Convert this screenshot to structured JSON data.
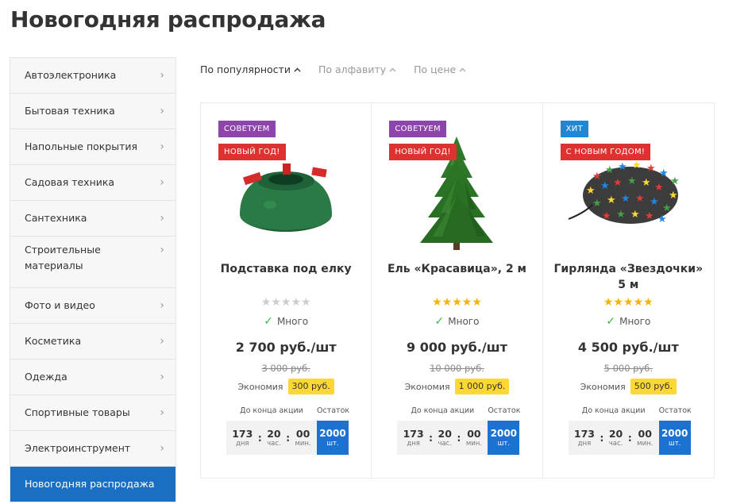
{
  "page": {
    "title": "Новогодняя распродажа"
  },
  "sidebar": {
    "items": [
      {
        "label": "Автоэлектроника"
      },
      {
        "label": "Бытовая техника"
      },
      {
        "label": "Напольные покрытия"
      },
      {
        "label": "Садовая техника"
      },
      {
        "label": "Сантехника"
      },
      {
        "label": "Строительные материалы"
      },
      {
        "label": "Фото и видео"
      },
      {
        "label": "Косметика"
      },
      {
        "label": "Одежда"
      },
      {
        "label": "Спортивные товары"
      },
      {
        "label": "Электроинструмент"
      },
      {
        "label": "Новогодняя распродажа"
      }
    ]
  },
  "sort": {
    "popularity": "По популярности",
    "alphabet": "По алфавиту",
    "price": "По цене"
  },
  "products": [
    {
      "badge1": "СОВЕТУЕМ",
      "badge2": "НОВЫЙ ГОД!",
      "name": "Подставка под елку",
      "rating": 0,
      "stock": "Много",
      "price": "2 700 руб./шт",
      "old_price": "3 000 руб.",
      "savings_label": "Экономия",
      "savings": "300 руб.",
      "timer_label": "До конца акции",
      "remain_label": "Остаток",
      "days": "173",
      "days_u": "дня",
      "hours": "20",
      "hours_u": "час.",
      "mins": "00",
      "mins_u": "мин.",
      "remain": "2000",
      "remain_u": "шт."
    },
    {
      "badge1": "СОВЕТУЕМ",
      "badge2": "НОВЫЙ ГОД!",
      "name": "Ель «Красавица», 2 м",
      "rating": 5,
      "stock": "Много",
      "price": "9 000 руб./шт",
      "old_price": "10 000 руб.",
      "savings_label": "Экономия",
      "savings": "1 000 руб.",
      "timer_label": "До конца акции",
      "remain_label": "Остаток",
      "days": "173",
      "days_u": "дня",
      "hours": "20",
      "hours_u": "час.",
      "mins": "00",
      "mins_u": "мин.",
      "remain": "2000",
      "remain_u": "шт."
    },
    {
      "badge1": "ХИТ",
      "badge2": "С НОВЫМ ГОДОМ!",
      "name": "Гирлянда «Звездочки» 5 м",
      "rating": 5,
      "stock": "Много",
      "price": "4 500 руб./шт",
      "old_price": "5 000 руб.",
      "savings_label": "Экономия",
      "savings": "500 руб.",
      "timer_label": "До конца акции",
      "remain_label": "Остаток",
      "days": "173",
      "days_u": "дня",
      "hours": "20",
      "hours_u": "час.",
      "mins": "00",
      "mins_u": "мин.",
      "remain": "2000",
      "remain_u": "шт."
    }
  ],
  "colors": {
    "accent": "#1b6fc2",
    "badge_recommend": "#8e44ad",
    "badge_newyear": "#e03131",
    "badge_hit": "#1e88d6",
    "star": "#f6b400",
    "savings_bg": "#fdd835",
    "stock_check": "#3bb54a"
  },
  "icons": {
    "chevron": "chevron-right-icon",
    "sort_arrow": "chevron-up-icon",
    "stock": "check-icon",
    "star": "star-icon"
  }
}
